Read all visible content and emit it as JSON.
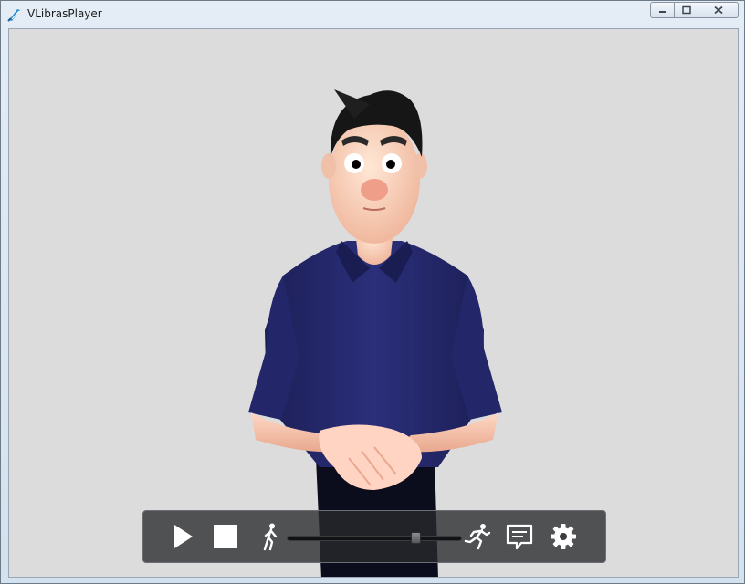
{
  "window": {
    "title": "VLibrasPlayer"
  },
  "icons": {
    "app": "vlibras-hand-icon",
    "minimize": "minimize-icon",
    "maximize": "maximize-icon",
    "close": "close-icon",
    "play": "play-icon",
    "stop": "stop-icon",
    "slow": "walking-person-icon",
    "fast": "running-person-icon",
    "subtitles": "subtitle-speech-bubble-icon",
    "settings": "gear-icon"
  },
  "player": {
    "speed_level": 0.75
  },
  "colors": {
    "viewport_background": "#dcdcdc",
    "control_bar": "#2e3033",
    "control_icon": "#ffffff",
    "shirt": "#23276a"
  }
}
